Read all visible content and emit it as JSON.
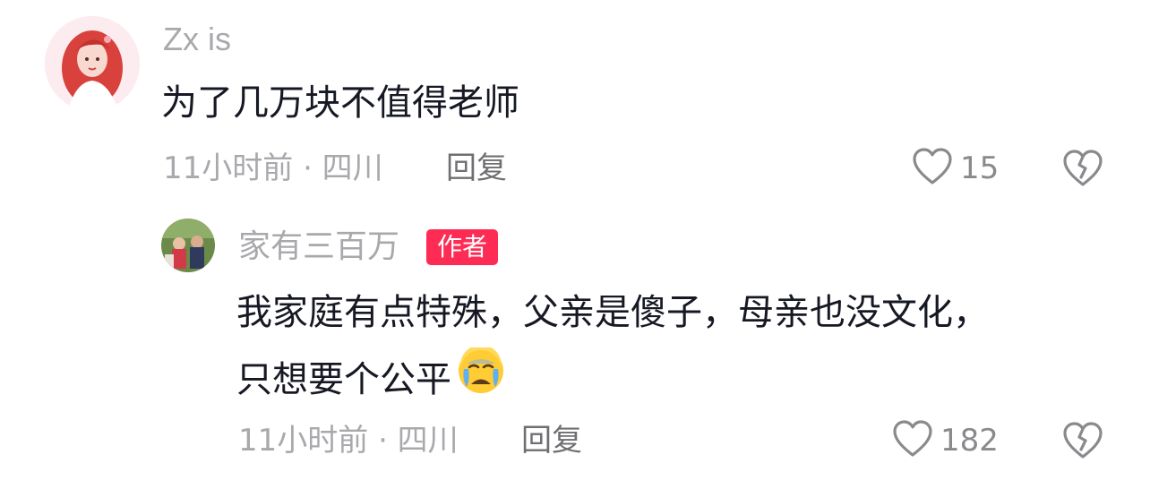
{
  "comment": {
    "username": "Zx is",
    "text": "为了几万块不值得老师",
    "time_location": "11小时前 · 四川",
    "reply_label": "回复",
    "like_count": "15"
  },
  "reply": {
    "username": "家有三百万",
    "author_badge": "作者",
    "text_line1": "我家庭有点特殊，父亲是傻子，母亲也没文化，",
    "text_line2": "只想要个公平",
    "time_location": "11小时前 · 四川",
    "reply_label": "回复",
    "like_count": "182"
  },
  "icons": {
    "like": "heart-outline-icon",
    "dislike": "broken-heart-icon",
    "emoji": "crying-face-emoji"
  },
  "colors": {
    "author_badge": "#fe2c55",
    "meta_text": "#a9a9ad",
    "body_text": "#161823"
  }
}
